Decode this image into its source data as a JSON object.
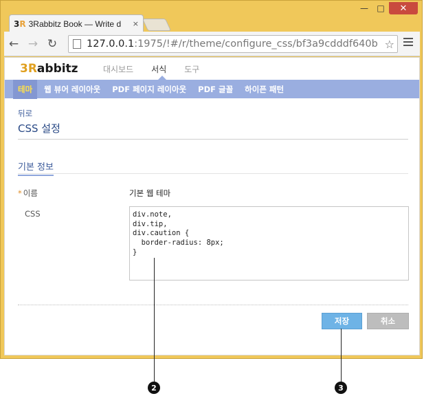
{
  "browser": {
    "tab_logo_a": "3",
    "tab_logo_b": "R",
    "tab_title": "3Rabbitz Book — Write d",
    "tab_close": "×",
    "url_host": "127.0.0.1",
    "url_rest": ":1975/!#/r/theme/configure_css/bf3a9cdddf640b",
    "controls": {
      "minimize": "—",
      "maximize": "□",
      "close": "✕"
    }
  },
  "app": {
    "logo_a": "3R",
    "logo_b": "abbitz",
    "top_nav": [
      {
        "label": "대시보드",
        "active": false
      },
      {
        "label": "서식",
        "active": true
      },
      {
        "label": "도구",
        "active": false
      }
    ],
    "sub_nav": [
      {
        "label": "테마",
        "active": true
      },
      {
        "label": "웹 뷰어 레이아웃",
        "active": false
      },
      {
        "label": "PDF 페이지 레이아웃",
        "active": false
      },
      {
        "label": "PDF 글꼴",
        "active": false
      },
      {
        "label": "하이픈 패턴",
        "active": false
      }
    ]
  },
  "page": {
    "back_link": "뒤로",
    "title": "CSS 설정",
    "section_title": "기본 정보",
    "fields": {
      "name_required": "*",
      "name_label": "이름",
      "name_value": "기본 웹 테마",
      "css_label": "CSS",
      "css_value": "div.note,\ndiv.tip,\ndiv.caution {\n  border-radius: 8px;\n}"
    },
    "buttons": {
      "save": "저장",
      "cancel": "취소"
    }
  },
  "callouts": [
    "2",
    "3"
  ],
  "colors": {
    "frame": "#f0c85a",
    "subnav": "#9aaee0",
    "active_sub": "#ffe04a",
    "save_button": "#6eb3e6",
    "cancel_button": "#bdbdbd"
  }
}
